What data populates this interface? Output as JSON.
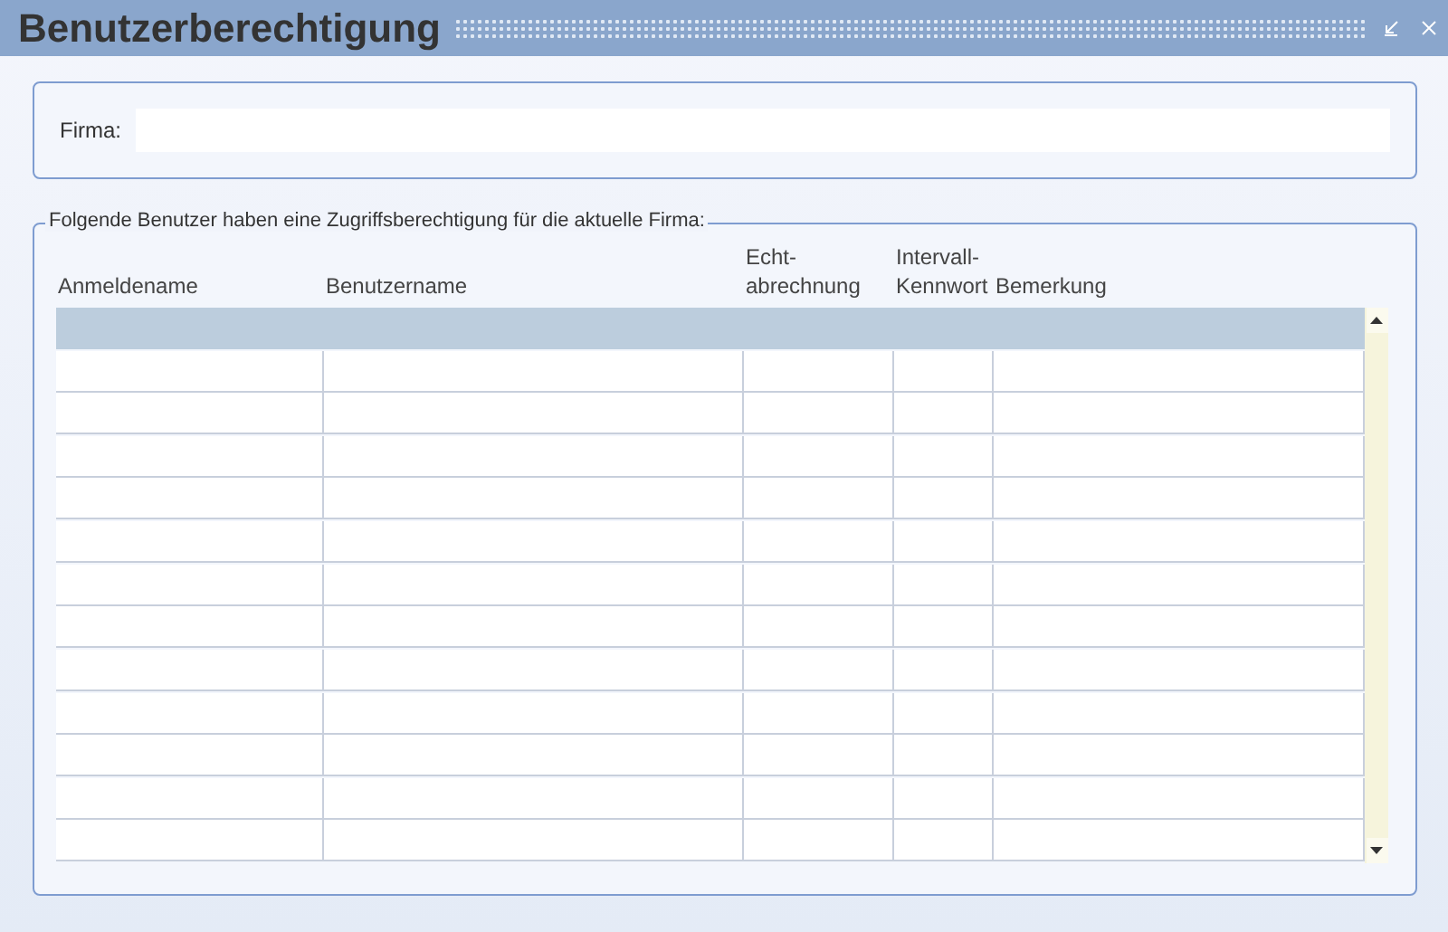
{
  "window": {
    "title": "Benutzerberechtigung"
  },
  "firma": {
    "label": "Firma:"
  },
  "group": {
    "legend": "Folgende Benutzer haben eine Zugriffsberechtigung für die aktuelle Firma:"
  },
  "table": {
    "columns": [
      [
        "Anmeldename"
      ],
      [
        "Benutzername"
      ],
      [
        "Echt-",
        "abrechnung"
      ],
      [
        "Intervall-",
        "Kennwort"
      ],
      [
        "Bemerkung"
      ]
    ],
    "rows": [
      {
        "selected": true
      },
      {
        "selected": false
      },
      {
        "selected": false
      },
      {
        "selected": false
      },
      {
        "selected": false
      },
      {
        "selected": false
      },
      {
        "selected": false
      },
      {
        "selected": false
      },
      {
        "selected": false
      },
      {
        "selected": false
      },
      {
        "selected": false
      },
      {
        "selected": false
      },
      {
        "selected": false
      }
    ]
  }
}
